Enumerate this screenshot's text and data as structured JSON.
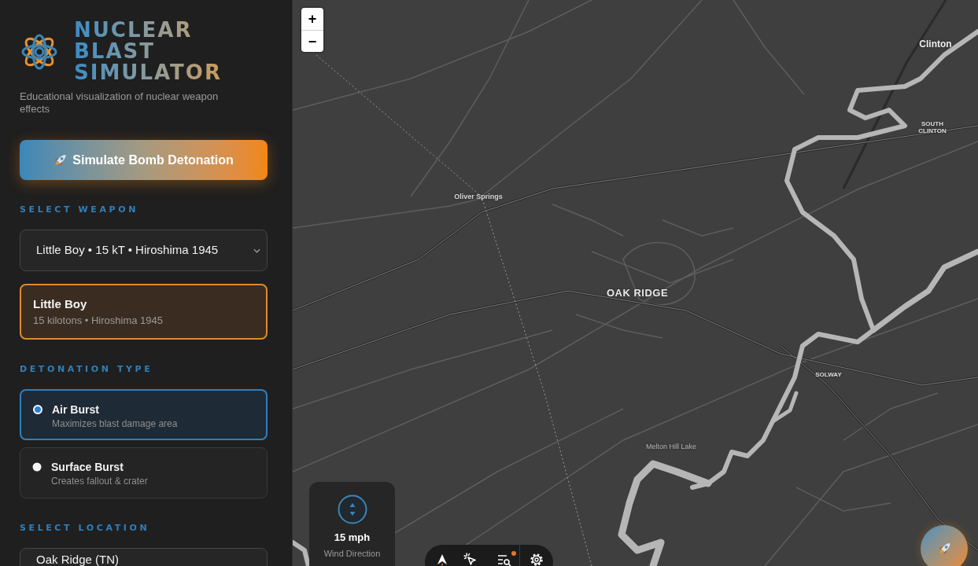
{
  "header": {
    "title": "NUCLEAR BLAST SIMULATOR",
    "subtitle": "Educational visualization of nuclear weapon effects"
  },
  "detonate_button": {
    "label": "Simulate Bomb Detonation"
  },
  "weapon": {
    "heading": "SELECT WEAPON",
    "select": {
      "value": "Little Boy • 15 kT • Hiroshima 1945"
    },
    "card": {
      "name": "Little Boy",
      "details": "15 kilotons • Hiroshima 1945"
    }
  },
  "detonation_type": {
    "heading": "DETONATION TYPE",
    "options": [
      {
        "label": "Air Burst",
        "description": "Maximizes blast damage area",
        "selected": true
      },
      {
        "label": "Surface Burst",
        "description": "Creates fallout & crater",
        "selected": false
      }
    ]
  },
  "location": {
    "heading": "SELECT LOCATION",
    "select": {
      "value": "Oak Ridge (TN)"
    }
  },
  "map": {
    "zoom_buttons": [
      {
        "kind": "in",
        "label": "+"
      },
      {
        "kind": "out",
        "label": "−"
      }
    ],
    "labels": [
      {
        "text": "Clinton",
        "kind": "town"
      },
      {
        "text": "SOUTH CLINTON",
        "kind": "district"
      },
      {
        "text": "Oliver Springs",
        "kind": "village"
      },
      {
        "text": "OAK RIDGE",
        "kind": "city"
      },
      {
        "text": "SOLWAY",
        "kind": "district"
      },
      {
        "text": "Melton Hill Lake",
        "kind": "water"
      }
    ],
    "wind": {
      "speed": "15 mph",
      "label": "Wind Direction"
    }
  }
}
